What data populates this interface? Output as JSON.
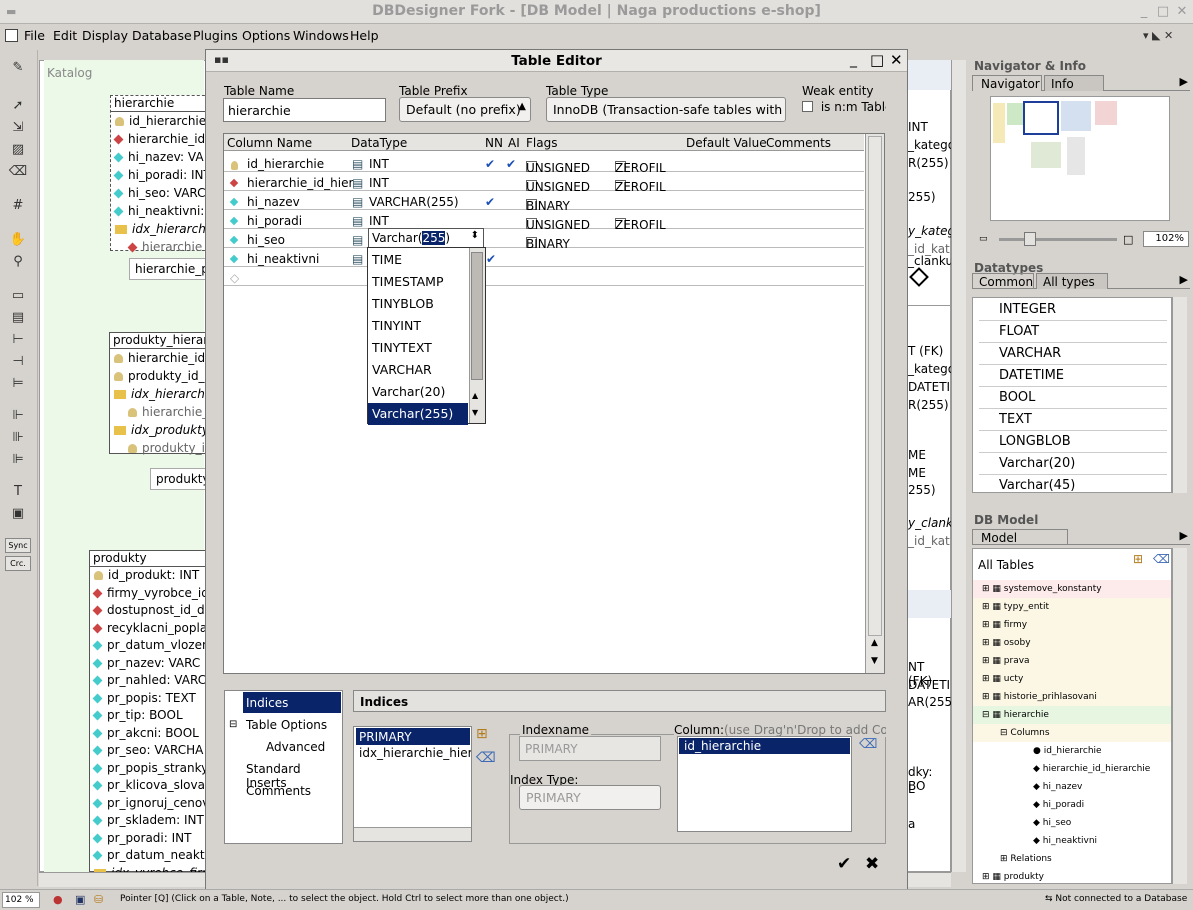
{
  "window": {
    "title": "DBDesigner Fork - [DB Model | Naga productions e-shop]"
  },
  "menu": [
    "File",
    "Edit",
    "Display",
    "Database",
    "Plugins",
    "Options",
    "Windows",
    "Help"
  ],
  "left_toolbar": {
    "sync": "Sync",
    "crc": "Crc."
  },
  "canvas": {
    "region_label": "Katalog",
    "table1": {
      "title": "hierarchie",
      "rows": [
        "id_hierarchie",
        "hierarchie_id",
        "hi_nazev: VA",
        "hi_poradi: INT",
        "hi_seo: VARC",
        "hi_neaktivni:",
        "idx_hierarchie",
        "hierarchie"
      ],
      "label": "hierarchie_p"
    },
    "table2": {
      "title": "produkty_hierarc",
      "rows": [
        "hierarchie_id",
        "produkty_id_p",
        "idx_hierarchie",
        "hierarchie_",
        "idx_produkty_",
        "produkty_i"
      ],
      "label": "produkty_"
    },
    "table3": {
      "title": "produkty",
      "rows": [
        "id_produkt: INT",
        "firmy_vyrobce_id",
        "dostupnost_id_do",
        "recyklacni_popla",
        "pr_datum_vlozen",
        "pr_nazev: VARC",
        "pr_nahled: VARC",
        "pr_popis: TEXT",
        "pr_tip: BOOL",
        "pr_akcni: BOOL",
        "pr_seo: VARCHA",
        "pr_popis_stranky",
        "pr_klicova_slova",
        "pr_ignoruj_cenov",
        "pr_skladem: INT",
        "pr_poradi: INT",
        "pr_datum_neaktiv",
        "idx_vyrobce_firm"
      ]
    },
    "right_fragments": [
      "INT",
      "_katego",
      "R(255)",
      "255)",
      "y_kateg",
      "_id_kat",
      "_clanku",
      "T (FK)",
      "_katego",
      "DATETIM",
      "R(255)",
      "ME",
      "ME",
      "255)",
      "y_clank",
      "_id_kat",
      "NT (FK)",
      "DATETI",
      "AR(255",
      "dky: BO",
      "L",
      "a"
    ]
  },
  "dialog": {
    "title": "Table Editor",
    "table_name_label": "Table Name",
    "table_name": "hierarchie",
    "prefix_label": "Table Prefix",
    "prefix": "Default (no prefix)",
    "type_label": "Table Type",
    "type": "InnoDB  (Transaction-safe tables with",
    "weak_label": "Weak entity",
    "weak_check": "is n:m Table",
    "columns_header": {
      "name": "Column Name",
      "type": "DataType",
      "nn": "NN",
      "ai": "AI",
      "flags": "Flags",
      "default": "Default Value",
      "comments": "Comments"
    },
    "rows": [
      {
        "name": "id_hierarchie",
        "type": "INT",
        "nn": "✔",
        "ai": "✔",
        "f1": "UNSIGNED",
        "f2": "ZEROFIL"
      },
      {
        "name": "hierarchie_id_hier",
        "type": "INT",
        "nn": "",
        "ai": "",
        "f1": "UNSIGNED",
        "f2": "ZEROFIL"
      },
      {
        "name": "hi_nazev",
        "type": "VARCHAR(255)",
        "nn": "✔",
        "ai": "",
        "f1": "BINARY",
        "f2": ""
      },
      {
        "name": "hi_poradi",
        "type": "INT",
        "nn": "",
        "ai": "",
        "f1": "UNSIGNED",
        "f2": "ZEROFIL"
      },
      {
        "name": "hi_seo",
        "type": "",
        "nn": "",
        "ai": "",
        "f1": "BINARY",
        "f2": ""
      },
      {
        "name": "hi_neaktivni",
        "type": "",
        "nn": "✔",
        "ai": "",
        "f1": "",
        "f2": ""
      }
    ],
    "editor_value_prefix": "Varchar(",
    "editor_value_sel": "255",
    ")": ")",
    "dropdown_items": [
      "TIME",
      "TIMESTAMP",
      "TINYBLOB",
      "TINYINT",
      "TINYTEXT",
      "VARCHAR",
      "Varchar(20)",
      "Varchar(255)"
    ],
    "options_tree": [
      "Indices",
      "Table Options",
      "Advanced",
      "Standard Inserts",
      "Comments"
    ],
    "indices_title": "Indices",
    "index_list": [
      "PRIMARY",
      "idx_hierarchie_hiera"
    ],
    "indexname_label": "Indexname",
    "indexname": "PRIMARY",
    "index_type_label": "Index Type:",
    "index_type": "PRIMARY",
    "column_label": "Column:",
    "column_hint": "(use Drag'n'Drop to add Colu",
    "index_columns": [
      "id_hierarchie"
    ]
  },
  "navigator": {
    "title": "Navigator & Info",
    "tabs": [
      "Navigator",
      "Info"
    ],
    "zoom": "102%"
  },
  "datatypes": {
    "title": "Datatypes",
    "tabs": [
      "Common",
      "All types"
    ],
    "items": [
      "INTEGER",
      "FLOAT",
      "VARCHAR",
      "DATETIME",
      "BOOL",
      "TEXT",
      "LONGBLOB",
      "Varchar(20)",
      "Varchar(45)"
    ]
  },
  "dbmodel": {
    "title": "DB Model",
    "tab": "Model",
    "root": "All Tables",
    "tables": [
      "systemove_konstanty",
      "typy_entit",
      "firmy",
      "osoby",
      "prava",
      "ucty",
      "historie_prihlasovani",
      "hierarchie"
    ],
    "columns_node": "Columns",
    "columns": [
      "id_hierarchie",
      "hierarchie_id_hierarchie",
      "hi_nazev",
      "hi_poradi",
      "hi_seo",
      "hi_neaktivni"
    ],
    "relations": "Relations",
    "last": "produkty"
  },
  "status": {
    "zoom": "102 %",
    "text": "Pointer [Q] (Click on a Table, Note, ... to select the object. Hold Ctrl to select more than one object.)",
    "db": "Not connected to a Database"
  }
}
